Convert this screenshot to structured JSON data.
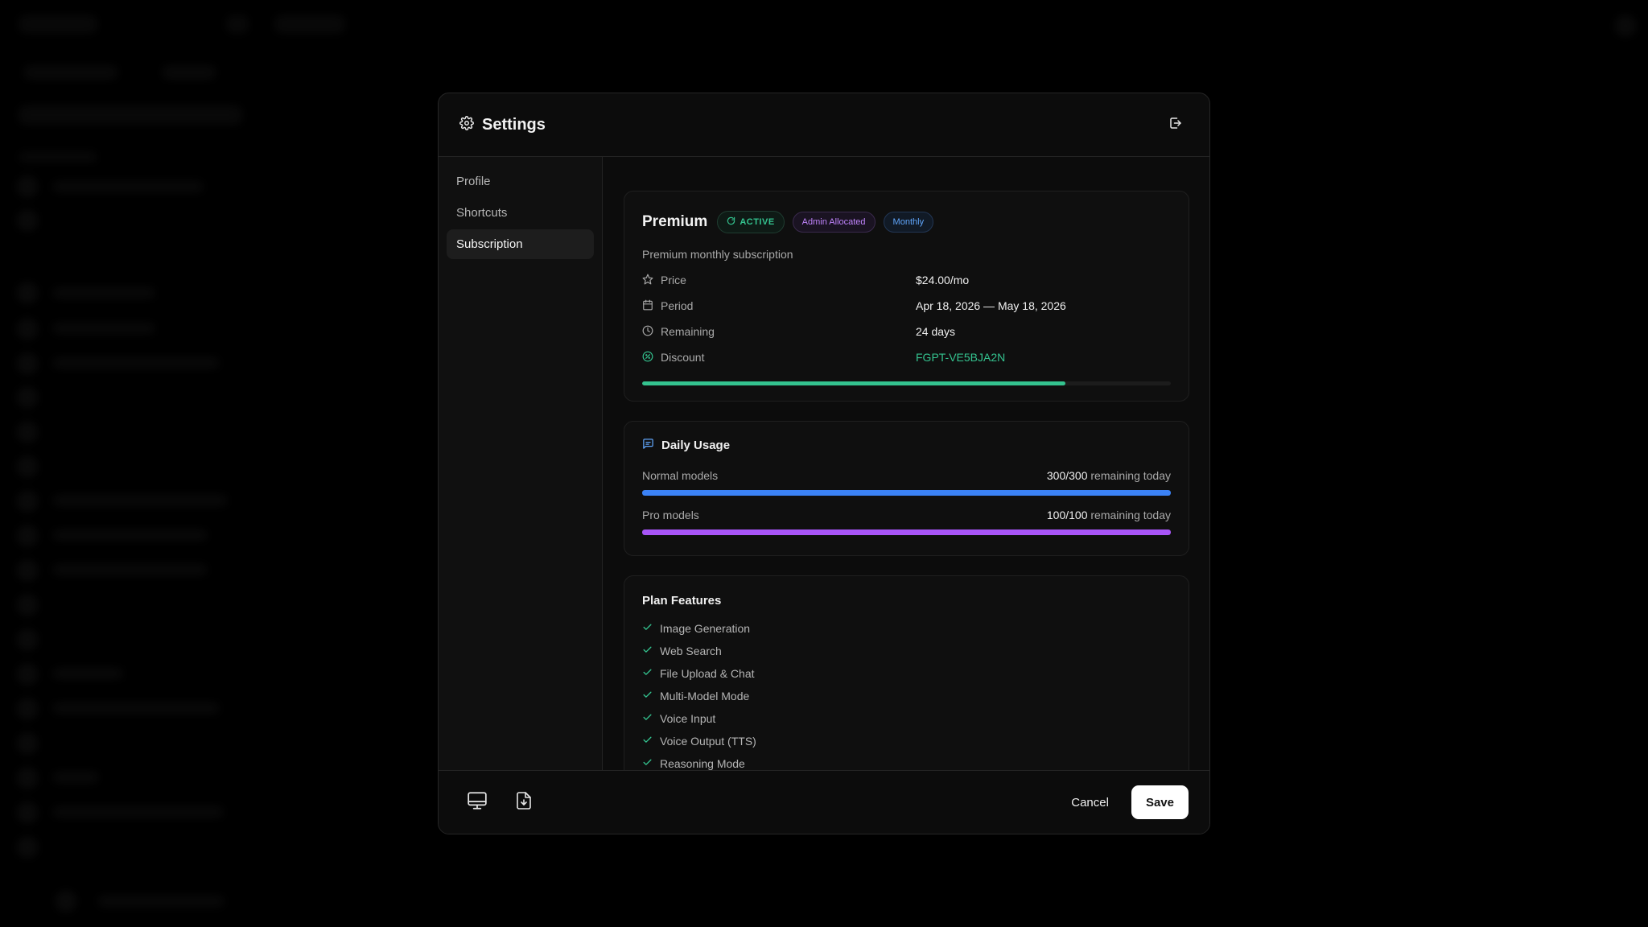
{
  "window": {
    "title": "Settings"
  },
  "sidebar": {
    "items": [
      {
        "label": "Profile"
      },
      {
        "label": "Shortcuts"
      },
      {
        "label": "Subscription"
      }
    ],
    "active": "Subscription"
  },
  "plan": {
    "name": "Premium",
    "badges": {
      "status": "ACTIVE",
      "allocation": "Admin Allocated",
      "billing": "Monthly"
    },
    "description": "Premium monthly subscription",
    "rows": [
      {
        "icon": "star-icon",
        "label": "Price",
        "value": "$24.00/mo"
      },
      {
        "icon": "calendar-icon",
        "label": "Period",
        "value": "Apr 18, 2026 — May 18, 2026"
      },
      {
        "icon": "clock-icon",
        "label": "Remaining",
        "value": "24 days"
      },
      {
        "icon": "discount-icon",
        "label": "Discount",
        "value": "FGPT-VE5BJA2N"
      }
    ],
    "period_progress": 0.8
  },
  "usage": {
    "title": "Daily Usage",
    "rows": [
      {
        "label": "Normal models",
        "count": "300/300",
        "suffix": "remaining today",
        "fraction": 1.0,
        "color": "#3b82f6"
      },
      {
        "label": "Pro models",
        "count": "100/100",
        "suffix": "remaining today",
        "fraction": 1.0,
        "color": "#a855f7"
      }
    ]
  },
  "features": {
    "title": "Plan Features",
    "items": [
      "Image Generation",
      "Web Search",
      "File Upload & Chat",
      "Multi-Model Mode",
      "Voice Input",
      "Voice Output (TTS)",
      "Reasoning Mode"
    ]
  },
  "footer": {
    "cancel_label": "Cancel",
    "save_label": "Save",
    "left_icons": [
      "monitor-icon",
      "file-download-icon"
    ]
  },
  "colors": {
    "accent_green": "#34c38f",
    "usage_blue": "#3b82f6",
    "usage_purple": "#a855f7"
  }
}
